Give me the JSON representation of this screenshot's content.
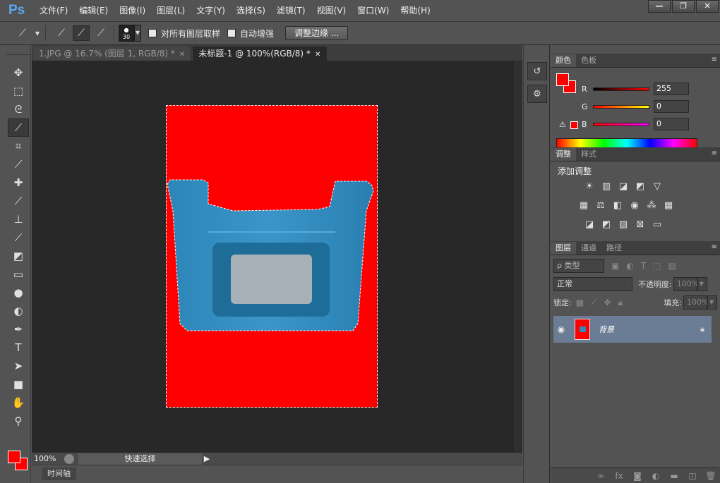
{
  "app": {
    "logo": "Ps"
  },
  "menu": [
    "文件(F)",
    "编辑(E)",
    "图像(I)",
    "图层(L)",
    "文字(Y)",
    "选择(S)",
    "滤镜(T)",
    "视图(V)",
    "窗口(W)",
    "帮助(H)"
  ],
  "window_controls": {
    "minimize": "—",
    "restore": "❐",
    "close": "✕"
  },
  "options": {
    "brush_size": "30",
    "sample_all_layers": "对所有图层取样",
    "auto_enhance": "自动增强",
    "refine_edge": "调整边缘 ..."
  },
  "tabs": [
    {
      "label": "1.JPG @ 16.7% (图层 1, RGB/8) *",
      "active": false
    },
    {
      "label": "未标题-1 @ 100%(RGB/8) *",
      "active": true
    }
  ],
  "status": {
    "zoom": "100%",
    "text": "快速选择"
  },
  "timeline": {
    "label": "时间轴"
  },
  "color_panel": {
    "tabs": [
      "颜色",
      "色板"
    ],
    "r": "255",
    "g": "0",
    "b": "0",
    "r_label": "R",
    "g_label": "G",
    "b_label": "B",
    "foreground": "#ff0000",
    "background": "#ff0000"
  },
  "adjustments_panel": {
    "tabs": [
      "调整",
      "样式"
    ],
    "title": "添加调整"
  },
  "layers_panel": {
    "tabs": [
      "图层",
      "通道",
      "路径"
    ],
    "kind_filter": "ρ 类型",
    "blend_mode": "正常",
    "opacity_label": "不透明度:",
    "opacity": "100%",
    "lock_label": "锁定:",
    "fill_label": "填充:",
    "fill": "100%",
    "layer_name": "背景"
  }
}
